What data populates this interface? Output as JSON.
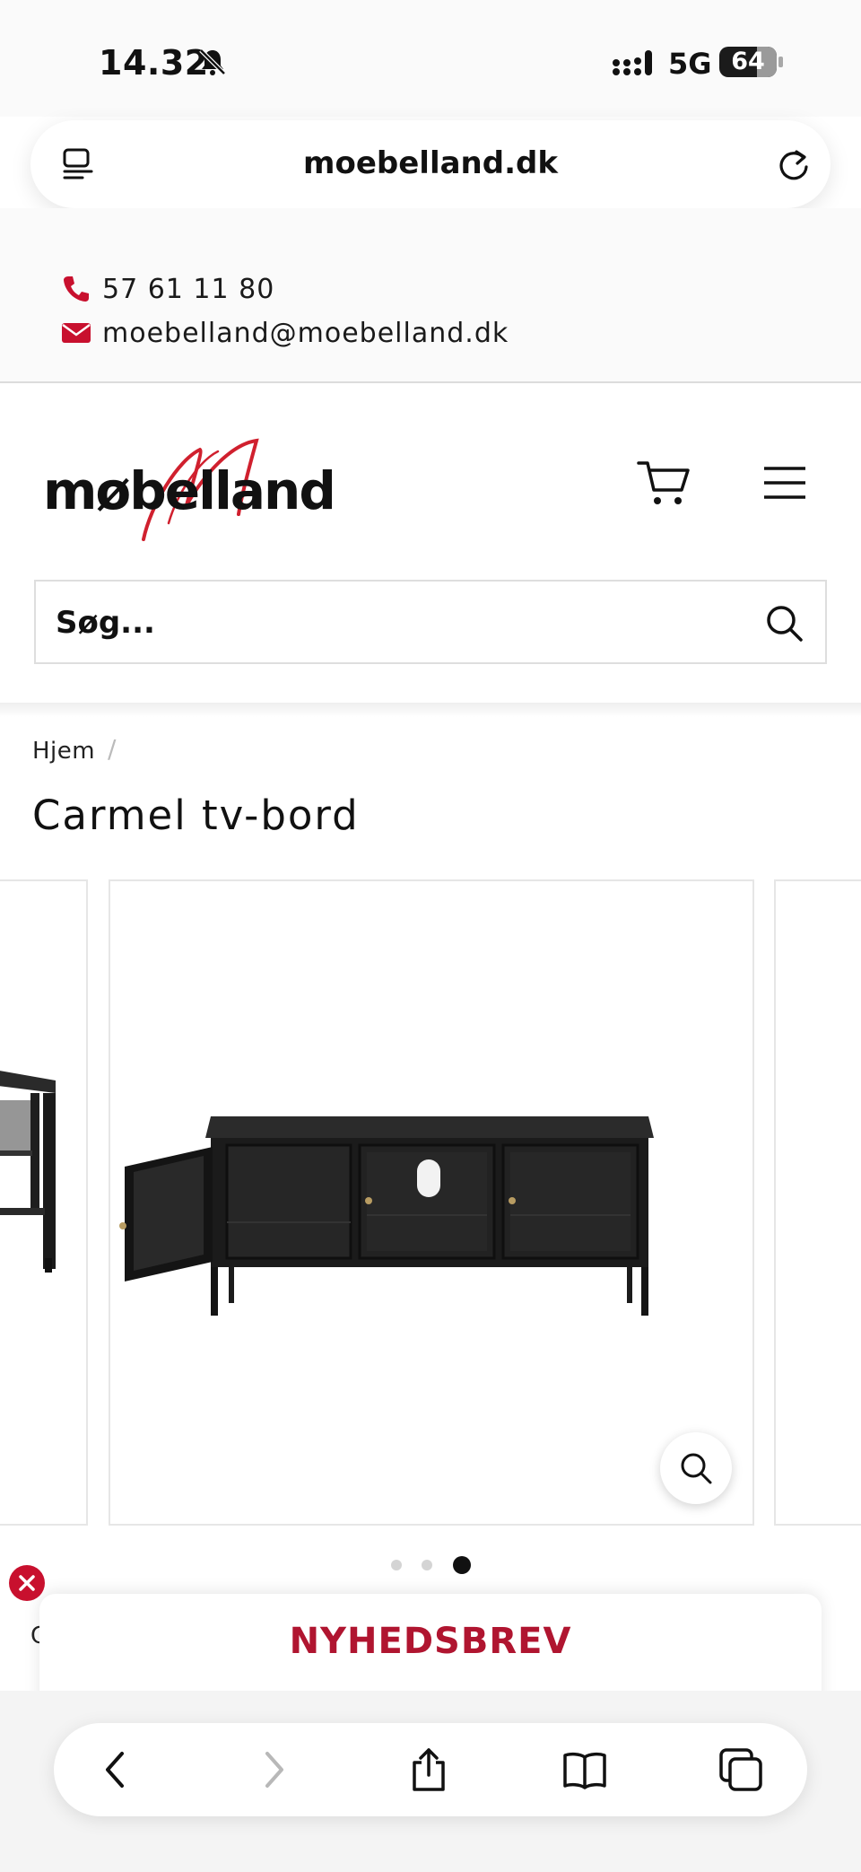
{
  "status": {
    "time": "14.32",
    "network": "5G",
    "battery": "64"
  },
  "browser": {
    "url": "moebelland.dk"
  },
  "contact": {
    "phone": "57 61 11 80",
    "email": "moebelland@moebelland.dk"
  },
  "header": {
    "logo_text": "møbelland",
    "search_placeholder": "Søg..."
  },
  "breadcrumb": {
    "home": "Hjem",
    "separator": "/"
  },
  "product": {
    "title": "Carmel tv-bord"
  },
  "gallery": {
    "slide_count": 3,
    "active_slide": 3
  },
  "newsletter": {
    "title": "NYHEDSBREV",
    "underlying_text": "C"
  },
  "colors": {
    "accent": "#c8102e",
    "newsletter_title": "#b01530",
    "text": "#111111"
  },
  "icons": [
    "bell-slash-icon",
    "signal-icon",
    "reader-icon",
    "reload-icon",
    "phone-icon",
    "envelope-icon",
    "cart-icon",
    "menu-icon",
    "search-icon",
    "zoom-icon",
    "close-icon",
    "back-icon",
    "forward-icon",
    "share-icon",
    "bookmarks-icon",
    "tabs-icon"
  ]
}
